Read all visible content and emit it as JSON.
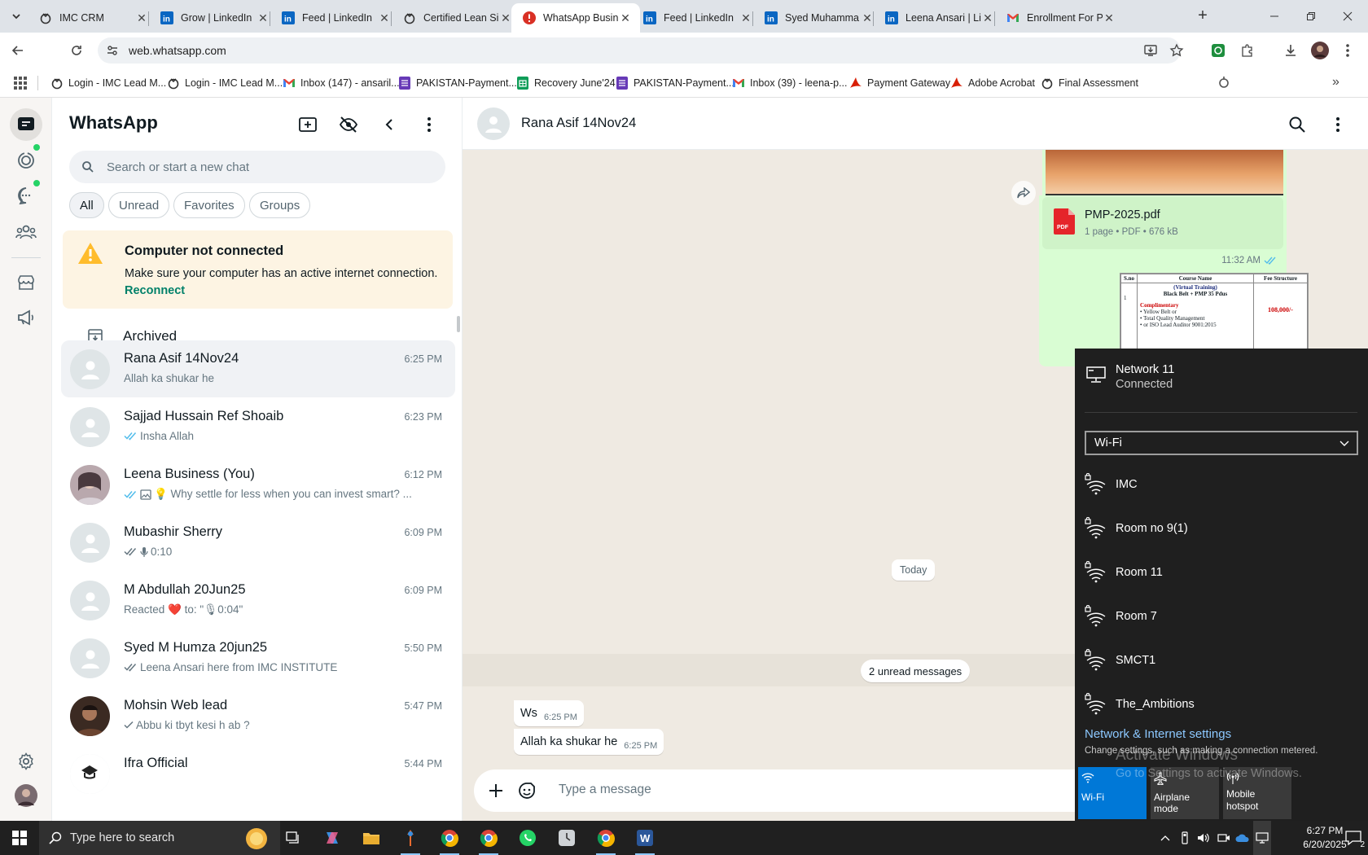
{
  "browser": {
    "tabs": [
      {
        "title": "IMC CRM",
        "favicon": "imc-icon",
        "active": false
      },
      {
        "title": "Grow | LinkedIn",
        "favicon": "linkedin-icon",
        "active": false
      },
      {
        "title": "Feed | LinkedIn",
        "favicon": "linkedin-icon",
        "active": false
      },
      {
        "title": "Certified Lean Si",
        "favicon": "imc-icon",
        "active": false
      },
      {
        "title": "WhatsApp Busin",
        "favicon": "alert-icon",
        "active": true
      },
      {
        "title": "Feed | LinkedIn",
        "favicon": "linkedin-icon",
        "active": false
      },
      {
        "title": "Syed Muhamma",
        "favicon": "linkedin-icon",
        "active": false
      },
      {
        "title": "Leena Ansari | Li",
        "favicon": "linkedin-icon",
        "active": false
      },
      {
        "title": "Enrollment For P",
        "favicon": "gmail-icon",
        "active": false
      }
    ],
    "url": "web.whatsapp.com",
    "bookmarks": [
      {
        "label": "Login - IMC Lead M...",
        "icon": "imc-icon"
      },
      {
        "label": "Login - IMC Lead M...",
        "icon": "imc-icon"
      },
      {
        "label": "Inbox (147) - ansaril...",
        "icon": "gmail-icon"
      },
      {
        "label": "PAKISTAN-Payment...",
        "icon": "forms-icon"
      },
      {
        "label": "Recovery June'24",
        "icon": "sheets-icon"
      },
      {
        "label": "PAKISTAN-Payment...",
        "icon": "forms-icon"
      },
      {
        "label": "Inbox (39) - leena-p...",
        "icon": "gmail-icon"
      },
      {
        "label": "Payment Gateway",
        "icon": "acrobat-icon"
      },
      {
        "label": "Adobe Acrobat",
        "icon": "acrobat-icon"
      },
      {
        "label": "Final Assessment",
        "icon": "imc-icon"
      }
    ]
  },
  "whatsapp": {
    "title": "WhatsApp",
    "search_placeholder": "Search or start a new chat",
    "filters": [
      "All",
      "Unread",
      "Favorites",
      "Groups"
    ],
    "active_filter": "All",
    "banner": {
      "title": "Computer not connected",
      "text": "Make sure your computer has an active internet connection.",
      "action": "Reconnect"
    },
    "archived_label": "Archived",
    "chats": [
      {
        "name": "Rana Asif 14Nov24",
        "time": "6:25 PM",
        "preview": "Allah ka shukar he",
        "ticks": "none",
        "selected": true,
        "avatar": "default"
      },
      {
        "name": "Sajjad Hussain Ref Shoaib",
        "time": "6:23 PM",
        "preview": "Insha Allah",
        "ticks": "double-blue",
        "selected": false,
        "avatar": "default"
      },
      {
        "name": "Leena Business (You)",
        "time": "6:12 PM",
        "preview": "💡 Why settle for less when you can invest smart? ...",
        "ticks": "double-blue",
        "selected": false,
        "avatar": "photo",
        "media": "image-icon"
      },
      {
        "name": "Mubashir Sherry",
        "time": "6:09 PM",
        "preview": "0:10",
        "ticks": "double-grey",
        "selected": false,
        "avatar": "default",
        "media": "mic-icon"
      },
      {
        "name": "M Abdullah 20Jun25",
        "time": "6:09 PM",
        "preview": "Reacted ❤️ to: \"🎙0:04\"",
        "ticks": "none",
        "selected": false,
        "avatar": "default"
      },
      {
        "name": "Syed M Humza 20jun25",
        "time": "5:50 PM",
        "preview": "Leena Ansari here from IMC INSTITUTE",
        "ticks": "double-grey",
        "selected": false,
        "avatar": "default"
      },
      {
        "name": "Mohsin Web lead",
        "time": "5:47 PM",
        "preview": "Abbu ki tbyt kesi h ab ?",
        "ticks": "single-grey",
        "selected": false,
        "avatar": "photo-dark"
      },
      {
        "name": "Ifra Official",
        "time": "5:44 PM",
        "preview": "",
        "ticks": "none",
        "selected": false,
        "avatar": "logo"
      }
    ],
    "conversation": {
      "contact": "Rana Asif 14Nov24",
      "document": {
        "name": "PMP-2025.pdf",
        "meta": "1 page • PDF • 676 kB",
        "time": "11:32 AM"
      },
      "preview_table": {
        "headers": [
          "S.no",
          "Course Name",
          "Fee Structure"
        ],
        "row_no": "1",
        "course_title_1": "(Virtual Training)",
        "course_title_2": "Black Belt + PMP 35 Pdus",
        "complimentary": "Complimentary",
        "bullets": [
          "Yellow Belt or",
          "Total Quality Management",
          "or ISO Lead Auditor 9001:2015"
        ],
        "fee": "108,000/-"
      },
      "date_divider": "Today",
      "unread_divider": "2 unread messages",
      "messages": [
        {
          "text": "Ws",
          "time": "6:25 PM"
        },
        {
          "text": "Allah ka shukar he",
          "time": "6:25 PM"
        }
      ],
      "composer_placeholder": "Type a message"
    }
  },
  "network_flyout": {
    "current_network": "Network 11",
    "current_status": "Connected",
    "adapter": "Wi-Fi",
    "networks": [
      "IMC",
      "Room no 9(1)",
      "Room 11",
      "Room 7",
      "SMCT1",
      "The_Ambitions"
    ],
    "settings_link": "Network & Internet settings",
    "settings_sub": "Change settings, such as making a connection metered.",
    "tiles": [
      {
        "label": "Wi-Fi",
        "active": true
      },
      {
        "label": "Airplane mode",
        "active": false
      },
      {
        "label": "Mobile hotspot",
        "active": false
      }
    ],
    "watermark_title": "Activate Windows",
    "watermark_sub": "Go to Settings to activate Windows."
  },
  "taskbar": {
    "search_placeholder": "Type here to search",
    "time": "6:27 PM",
    "date": "6/20/2025",
    "notification_count": "2"
  },
  "colors": {
    "wa_green": "#008069",
    "bubble_out": "#d9fdd3",
    "chat_bg": "#efeae2",
    "link_blue": "#53bdeb",
    "taskbar": "#202020"
  }
}
